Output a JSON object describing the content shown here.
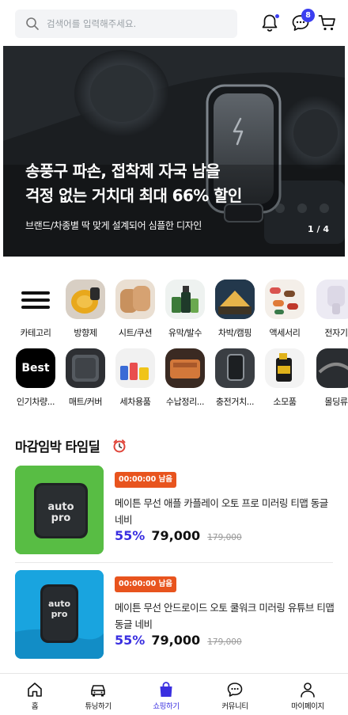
{
  "header": {
    "search_placeholder": "검색어를 입력해주세요.",
    "chat_badge": "8",
    "icons": [
      "search-icon",
      "bell-icon",
      "chat-icon",
      "cart-icon"
    ],
    "accent_color": "#3b3ef0"
  },
  "hero": {
    "title_line1": "송풍구 파손, 접착제 자국 남을",
    "title_line2": "걱정 없는 거치대 최대 66% 할인",
    "subtitle": "브랜드/차종별 딱 맞게 설계되어 심플한 디자인",
    "pagination": "1 / 4"
  },
  "categories": {
    "row1": [
      {
        "label": "카테고리",
        "icon": "menu-icon"
      },
      {
        "label": "방향제"
      },
      {
        "label": "시트/쿠션"
      },
      {
        "label": "유막/발수"
      },
      {
        "label": "차박/캠핑"
      },
      {
        "label": "액세서리"
      },
      {
        "label": "전자기"
      }
    ],
    "row2": [
      {
        "label": "인기차량...",
        "badge": "Best"
      },
      {
        "label": "매트/커버"
      },
      {
        "label": "세차용품"
      },
      {
        "label": "수납정리..."
      },
      {
        "label": "충전거치..."
      },
      {
        "label": "소모품"
      },
      {
        "label": "몰딩류"
      }
    ]
  },
  "deals": {
    "title": "마감임박 타임딜",
    "items": [
      {
        "timer": "00:00:00 남음",
        "name": "메이튼 무선 애플 카플레이 오토 프로 미러링 티맵 동글 네비",
        "discount": "55%",
        "price": "79,000",
        "original_price": "179,000"
      },
      {
        "timer": "00:00:00 남음",
        "name": "메이튼 무선 안드로이드 오토 쿨워크 미러링 유튜브 티맵 동글 네비",
        "discount": "55%",
        "price": "79,000",
        "original_price": "179,000"
      }
    ]
  },
  "bottom_nav": {
    "items": [
      {
        "label": "홈",
        "icon": "home-icon"
      },
      {
        "label": "튜닝하기",
        "icon": "car-icon"
      },
      {
        "label": "쇼핑하기",
        "icon": "shopping-bag-icon",
        "active": true
      },
      {
        "label": "커뮤니티",
        "icon": "community-icon"
      },
      {
        "label": "마이페이지",
        "icon": "person-icon"
      }
    ],
    "active_color": "#3a2fe0"
  }
}
